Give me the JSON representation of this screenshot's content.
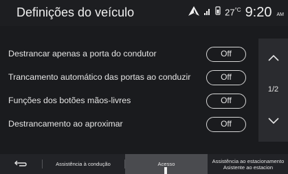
{
  "header": {
    "title": "Definições do veículo",
    "temperature": "27",
    "temperature_unit": "°C",
    "time": "9:20",
    "ampm": "AM",
    "icons": [
      "navigation-arrow-icon",
      "signal-icon",
      "phone-battery-icon"
    ]
  },
  "settings": {
    "rows": [
      {
        "label": "Destrancar apenas a porta do condutor",
        "value": "Off"
      },
      {
        "label": "Trancamento automático das portas ao conduzir",
        "value": "Off"
      },
      {
        "label": "Funções dos botões mãos-livres",
        "value": "Off"
      },
      {
        "label": "Destrancamento ao aproximar",
        "value": "Off"
      }
    ]
  },
  "scroll": {
    "page_indicator": "1/2",
    "up_icon": "chevron-up-icon",
    "down_icon": "chevron-down-icon"
  },
  "tabs": {
    "back_icon": "back-arrow-icon",
    "items": [
      {
        "label": "Assistência à condução"
      },
      {
        "label": "Acesso",
        "active": true
      },
      {
        "label": "Assistência ao estacionamento"
      },
      {
        "label": "Asistente ao estacion"
      }
    ]
  }
}
